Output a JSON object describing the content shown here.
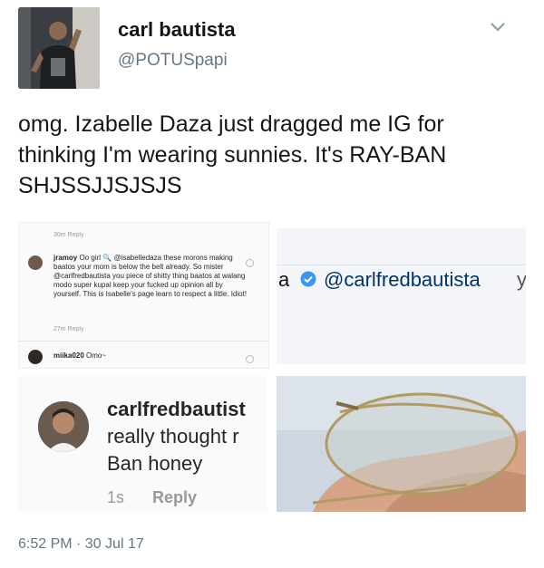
{
  "author": {
    "name": "carl bautista",
    "handle": "@POTUSpapi"
  },
  "tweet": {
    "text": "omg. Izabelle Daza just dragged me IG for thinking I'm wearing sunnies. It's RAY-BAN SHJSSJJSJSJS"
  },
  "panel1": {
    "top_meta": "30m   Reply",
    "comment_user": "jramoy",
    "comment_text": "Oo girl 🔍 @isabelledaza these morons making baatos your mom is below the belt already. So mister @carlfredbautista you piece of shitty thing baatos at walang modo super kupal keep your fucked up opinion all by yourself. This is Isabelle's page learn to respect a little. Idiot!",
    "comment_meta": "27m   Reply",
    "second_user": "miika020",
    "second_text": "Omo~"
  },
  "panel2": {
    "prefix": "a",
    "mention": "@carlfredbautista",
    "suffix": "y"
  },
  "panel3": {
    "username": "carlfredbautist",
    "text_line1": "really thought r",
    "text_line2": "Ban honey",
    "time": "1s",
    "reply": "Reply"
  },
  "timestamp": "6:52 PM · 30 Jul 17",
  "colors": {
    "handle_gray": "#657786",
    "verified_blue": "#3897f0"
  },
  "icons": {
    "menu": "chevron-down-icon",
    "verified": "verified-badge-icon"
  }
}
